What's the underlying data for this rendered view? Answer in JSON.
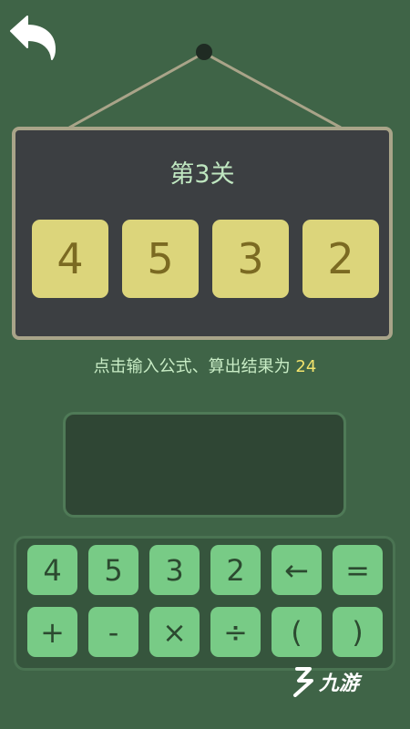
{
  "level": {
    "title": "第3关"
  },
  "cards": [
    "4",
    "5",
    "3",
    "2"
  ],
  "instruction": {
    "text": "点击输入公式、算出结果为",
    "target": "24"
  },
  "formula": {
    "value": ""
  },
  "keypad": {
    "row1": [
      "4",
      "5",
      "3",
      "2",
      "←",
      "="
    ],
    "row2": [
      "+",
      "-",
      "×",
      "÷",
      "(",
      ")"
    ]
  },
  "watermark": {
    "text": "九游"
  },
  "colors": {
    "background": "#3f6447",
    "board": "#3c3f42",
    "card": "#dcd57b",
    "key": "#78cb86",
    "target": "#f2e36c"
  },
  "icons": {
    "back": "back-arrow-icon",
    "logo": "jiuyou-logo-icon"
  }
}
